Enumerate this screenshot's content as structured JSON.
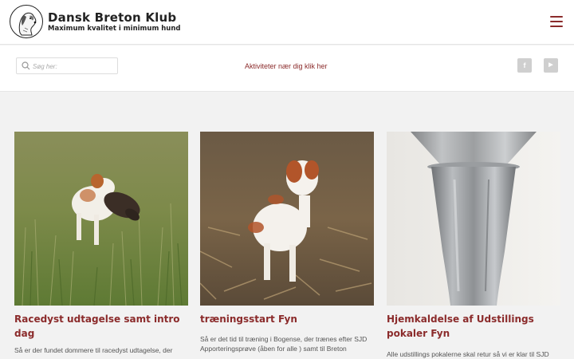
{
  "header": {
    "title": "Dansk Breton Klub",
    "subtitle": "Maximum kvalitet i minimum hund",
    "logo_icon": "dog-head-logo",
    "menu_icon": "hamburger-menu-icon"
  },
  "subbar": {
    "search_placeholder": "Søg her:",
    "activities_link": "Aktiviteter nær dig klik her",
    "social": [
      {
        "icon": "facebook-icon",
        "glyph": "f"
      },
      {
        "icon": "youtube-icon",
        "glyph": "▶"
      }
    ]
  },
  "colors": {
    "accent": "#8b2b2b",
    "background": "#f2f2f2"
  },
  "posts": [
    {
      "title": "Racedyst udtagelse samt intro dag",
      "excerpt": "Så er der fundet dommere til racedyst udtagelse, der",
      "image": "breton dog retrieving bird in tall grass"
    },
    {
      "title": "træningsstart Fyn",
      "excerpt": "Så er det tid til træning i Bogense, der trænes efter SJD Apporteringsprøve (åben for alle ) samt til Breton",
      "image": "white and orange breton dog in stubble field"
    },
    {
      "title": "Hjemkaldelse af Udstillings pokaler Fyn",
      "excerpt": "Alle udstillings pokalerne skal retur så vi er klar til SJD",
      "image": "silver trophy vase against white wall"
    }
  ]
}
